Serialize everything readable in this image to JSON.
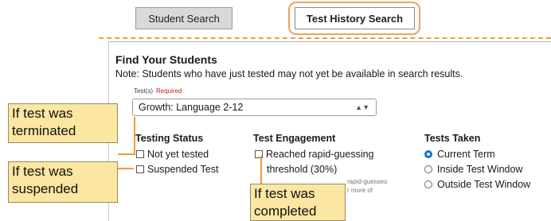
{
  "tabs": {
    "student_search": "Student Search",
    "test_history_search": "Test History Search"
  },
  "form": {
    "title": "Find Your Students",
    "note": "Note: Students who have just tested may not yet be available in search results.",
    "tests_label": "Test(s)",
    "required_label": "Required",
    "test_select_value": "Growth: Language 2-12"
  },
  "testing_status": {
    "heading": "Testing Status",
    "options": [
      "Not yet tested",
      "Suspended Test"
    ]
  },
  "test_engagement": {
    "heading": "Test Engagement",
    "option_line1": "Reached rapid-guessing",
    "option_line2": "threshold (30%)",
    "faded_line1": "rapid-guesses",
    "faded_line2": "r more of"
  },
  "tests_taken": {
    "heading": "Tests Taken",
    "options": [
      "Current Term",
      "Inside Test Window",
      "Outside Test Window"
    ],
    "selected": "Current Term"
  },
  "callouts": {
    "terminated_line1": "If test was",
    "terminated_line2": "terminated",
    "suspended_line1": "If test was",
    "suspended_line2": "suspended",
    "completed_line1": "If test was",
    "completed_line2": "completed"
  },
  "colors": {
    "annotation_orange": "#f39a3b",
    "callout_fill": "#fbe6a2",
    "radio_selected": "#1673c9",
    "required_red": "#d01818"
  }
}
